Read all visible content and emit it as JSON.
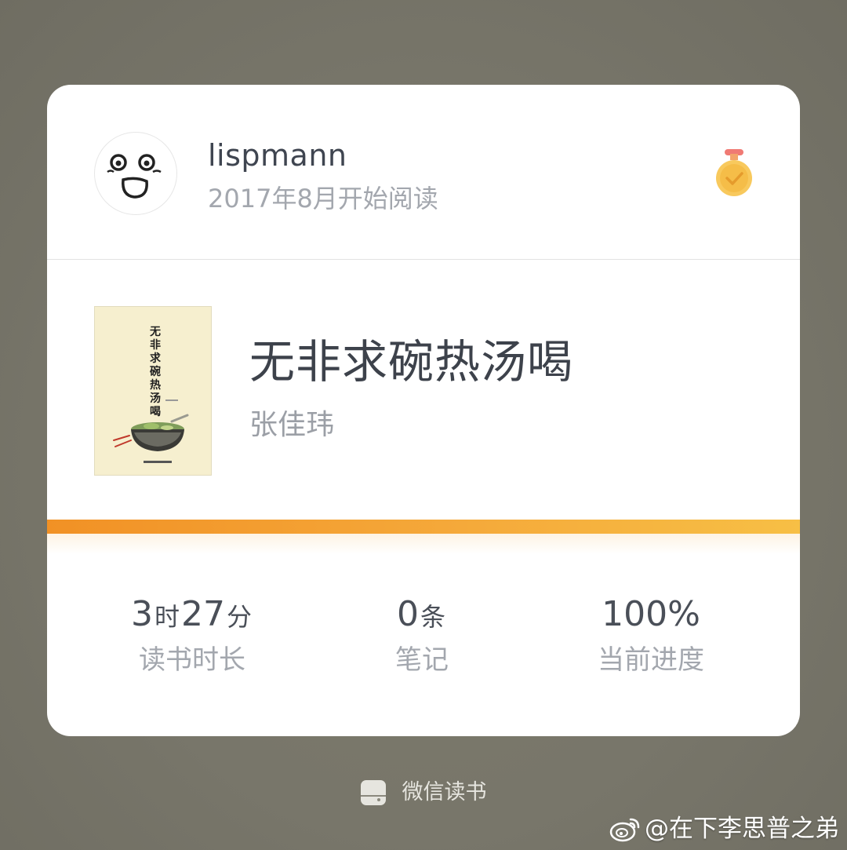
{
  "profile": {
    "username": "lispmann",
    "since": "2017年8月开始阅读",
    "avatar_icon": "surprised-face-avatar",
    "badge_icon": "medal-icon"
  },
  "book": {
    "title": "无非求碗热汤喝",
    "author": "张佳玮",
    "cover_title": "无非求碗热汤喝"
  },
  "progress": {
    "fraction": 1.0
  },
  "stats": [
    {
      "parts": [
        {
          "num": "3"
        },
        {
          "unit": "时"
        },
        {
          "num": "27"
        },
        {
          "unit": "分"
        }
      ],
      "label": "读书时长"
    },
    {
      "parts": [
        {
          "num": "0"
        },
        {
          "unit": "条"
        }
      ],
      "label": "笔记"
    },
    {
      "parts": [
        {
          "num": "100%"
        }
      ],
      "label": "当前进度"
    }
  ],
  "stat_values": {
    "time_hours": "3",
    "time_hours_unit": "时",
    "time_minutes": "27",
    "time_minutes_unit": "分",
    "notes_count": "0",
    "notes_unit": "条",
    "progress_value": "100%"
  },
  "stat_labels": {
    "time": "读书时长",
    "notes": "笔记",
    "progress": "当前进度"
  },
  "footer": {
    "brand_label": "微信读书",
    "brand_icon": "weread-logo-icon"
  },
  "watermark": {
    "text": "@在下李思普之弟",
    "icon": "weibo-logo-icon"
  },
  "colors": {
    "background": "#78766a",
    "card": "#ffffff",
    "progress_start": "#f19125",
    "progress_end": "#f7bf45",
    "medal": "#f8c95d",
    "medal_ribbon": "#f07a74"
  }
}
